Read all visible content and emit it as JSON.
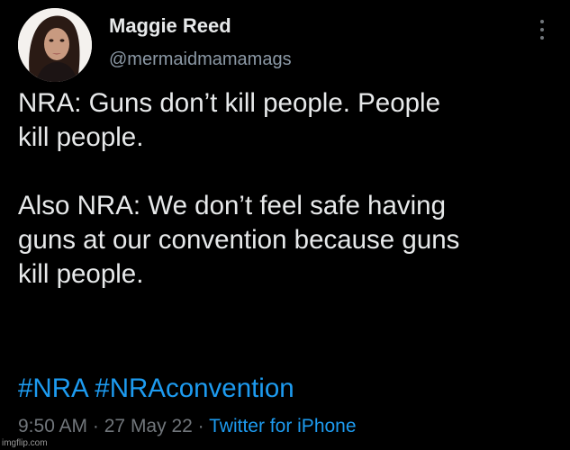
{
  "tweet": {
    "author": {
      "display_name": "Maggie Reed",
      "handle": "@mermaidmamamags",
      "avatar_icon": "profile-photo"
    },
    "more_icon": "vertical-ellipsis-icon",
    "text": {
      "paragraph_1_line_1": "NRA: Guns don’t kill people. People",
      "paragraph_1_line_2": "kill people.",
      "paragraph_2_line_1": "Also NRA: We don’t feel safe having",
      "paragraph_2_line_2": "guns at our convention because guns",
      "paragraph_2_line_3": "kill people."
    },
    "hashtags": [
      "#NRA",
      "#NRAconvention"
    ],
    "time": "9:50 AM",
    "date": "27 May 22",
    "source": "Twitter for iPhone",
    "separator": "·"
  },
  "watermark": "imgflip.com",
  "colors": {
    "background": "#000000",
    "text_primary": "#e7e9ea",
    "text_secondary": "#71767b",
    "accent": "#1d9bf0"
  }
}
